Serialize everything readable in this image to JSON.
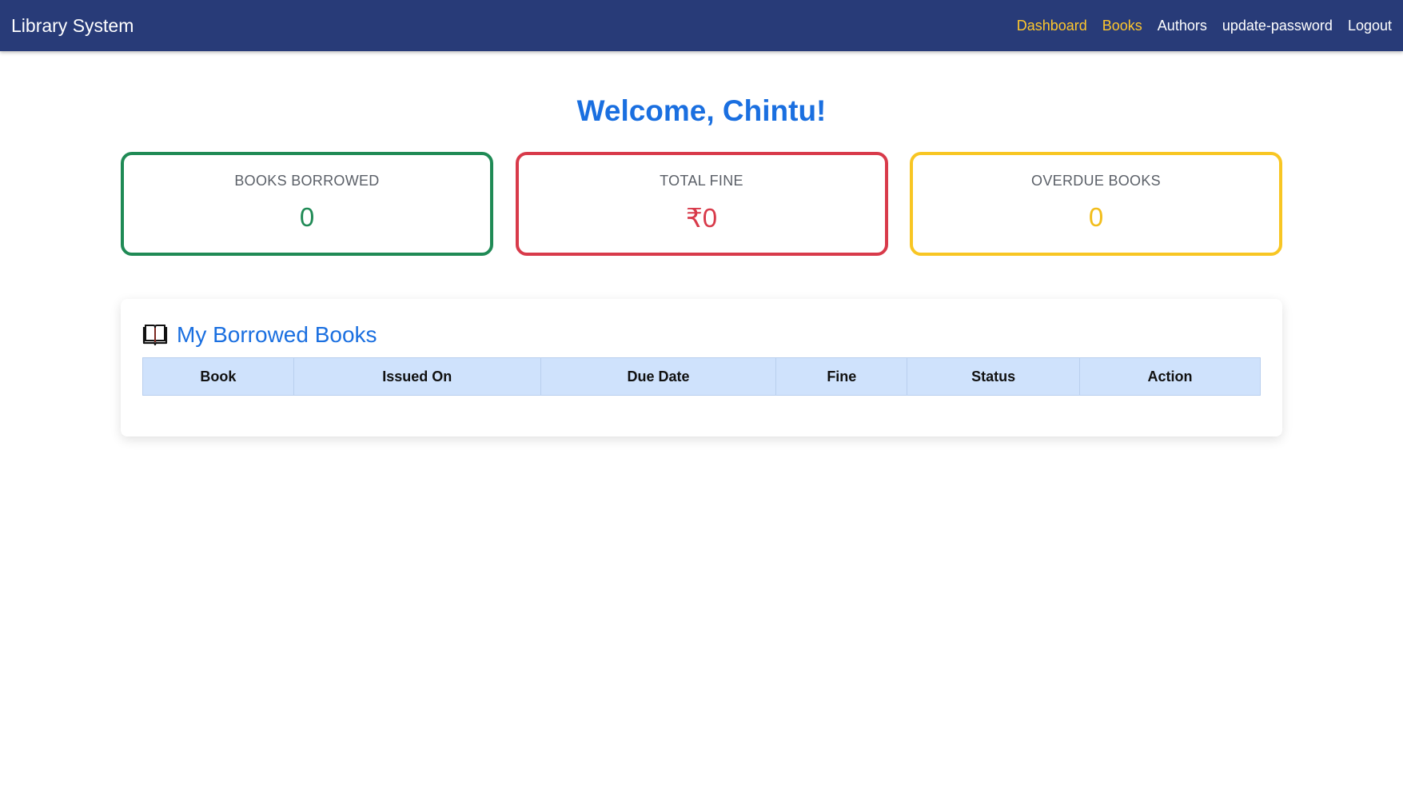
{
  "navbar": {
    "brand": "Library System",
    "links": [
      {
        "label": "Dashboard",
        "active": true
      },
      {
        "label": "Books",
        "active": true
      },
      {
        "label": "Authors",
        "active": false
      },
      {
        "label": "update-password",
        "active": false
      },
      {
        "label": "Logout",
        "active": false
      }
    ]
  },
  "welcome": "Welcome, Chintu!",
  "stats": [
    {
      "label": "BOOKS BORROWED",
      "value": "0",
      "color": "#1f8a55"
    },
    {
      "label": "TOTAL FINE",
      "value": "₹0",
      "color": "#d83a4a"
    },
    {
      "label": "OVERDUE BOOKS",
      "value": "0",
      "color": "#f2bd1a"
    }
  ],
  "borrowed": {
    "icon": "open-book-icon",
    "title": "My Borrowed Books",
    "columns": [
      "Book",
      "Issued On",
      "Due Date",
      "Fine",
      "Status",
      "Action"
    ],
    "rows": []
  },
  "colors": {
    "navbar_bg": "#283b78",
    "nav_active": "#ffc72c",
    "accent_blue": "#1a6fe0",
    "table_header_bg": "#cfe2fc"
  }
}
